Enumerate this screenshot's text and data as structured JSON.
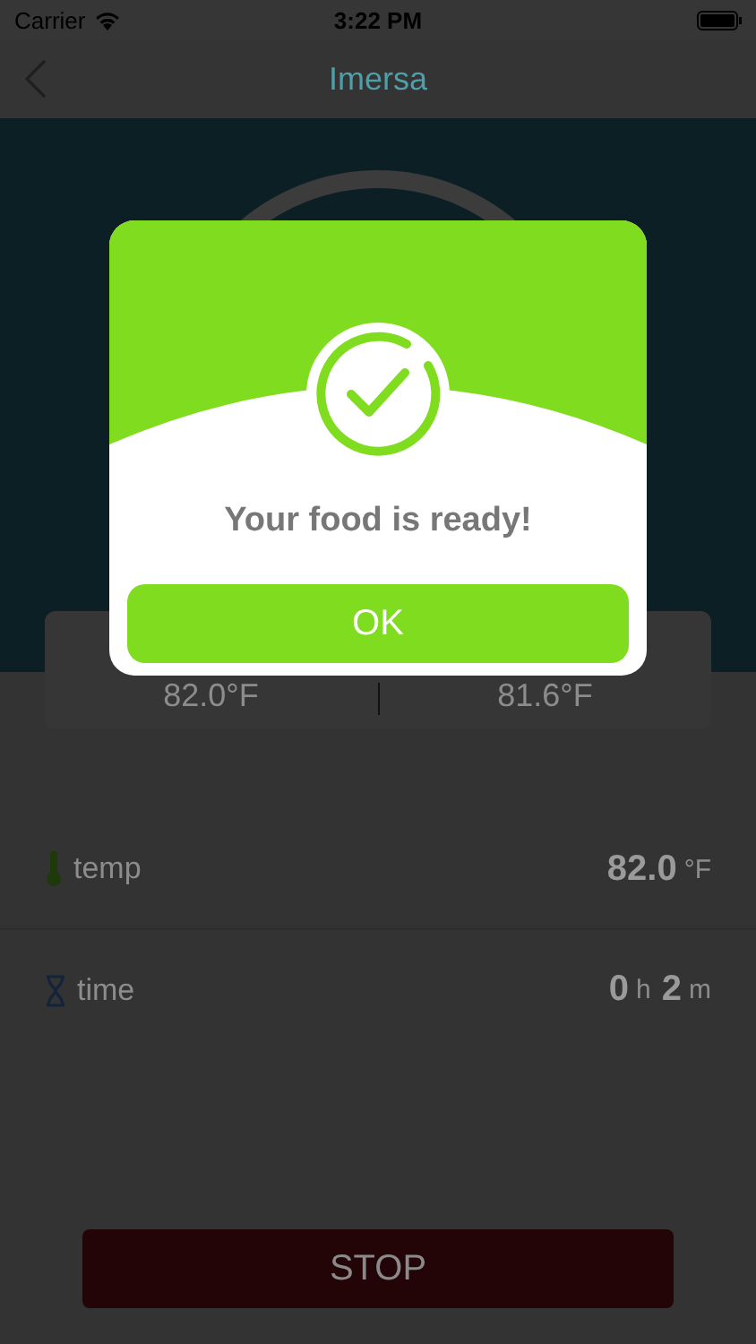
{
  "status_bar": {
    "carrier": "Carrier",
    "time": "3:22 PM"
  },
  "nav": {
    "title": "Imersa"
  },
  "gauge_card": {
    "left": "82.0°F",
    "right": "81.6°F"
  },
  "readings": [
    {
      "kind": "temp",
      "label": "temp",
      "parts": [
        {
          "kind": "value",
          "text": "82.0"
        },
        {
          "kind": "unit",
          "text": "°F"
        }
      ]
    },
    {
      "kind": "time",
      "label": "time",
      "parts": [
        {
          "kind": "value",
          "text": "0"
        },
        {
          "kind": "unit",
          "text": "h"
        },
        {
          "kind": "value",
          "text": "2"
        },
        {
          "kind": "unit",
          "text": "m"
        }
      ]
    }
  ],
  "stop_button": "STOP",
  "dialog": {
    "message": "Your food is ready!",
    "button": "OK"
  }
}
